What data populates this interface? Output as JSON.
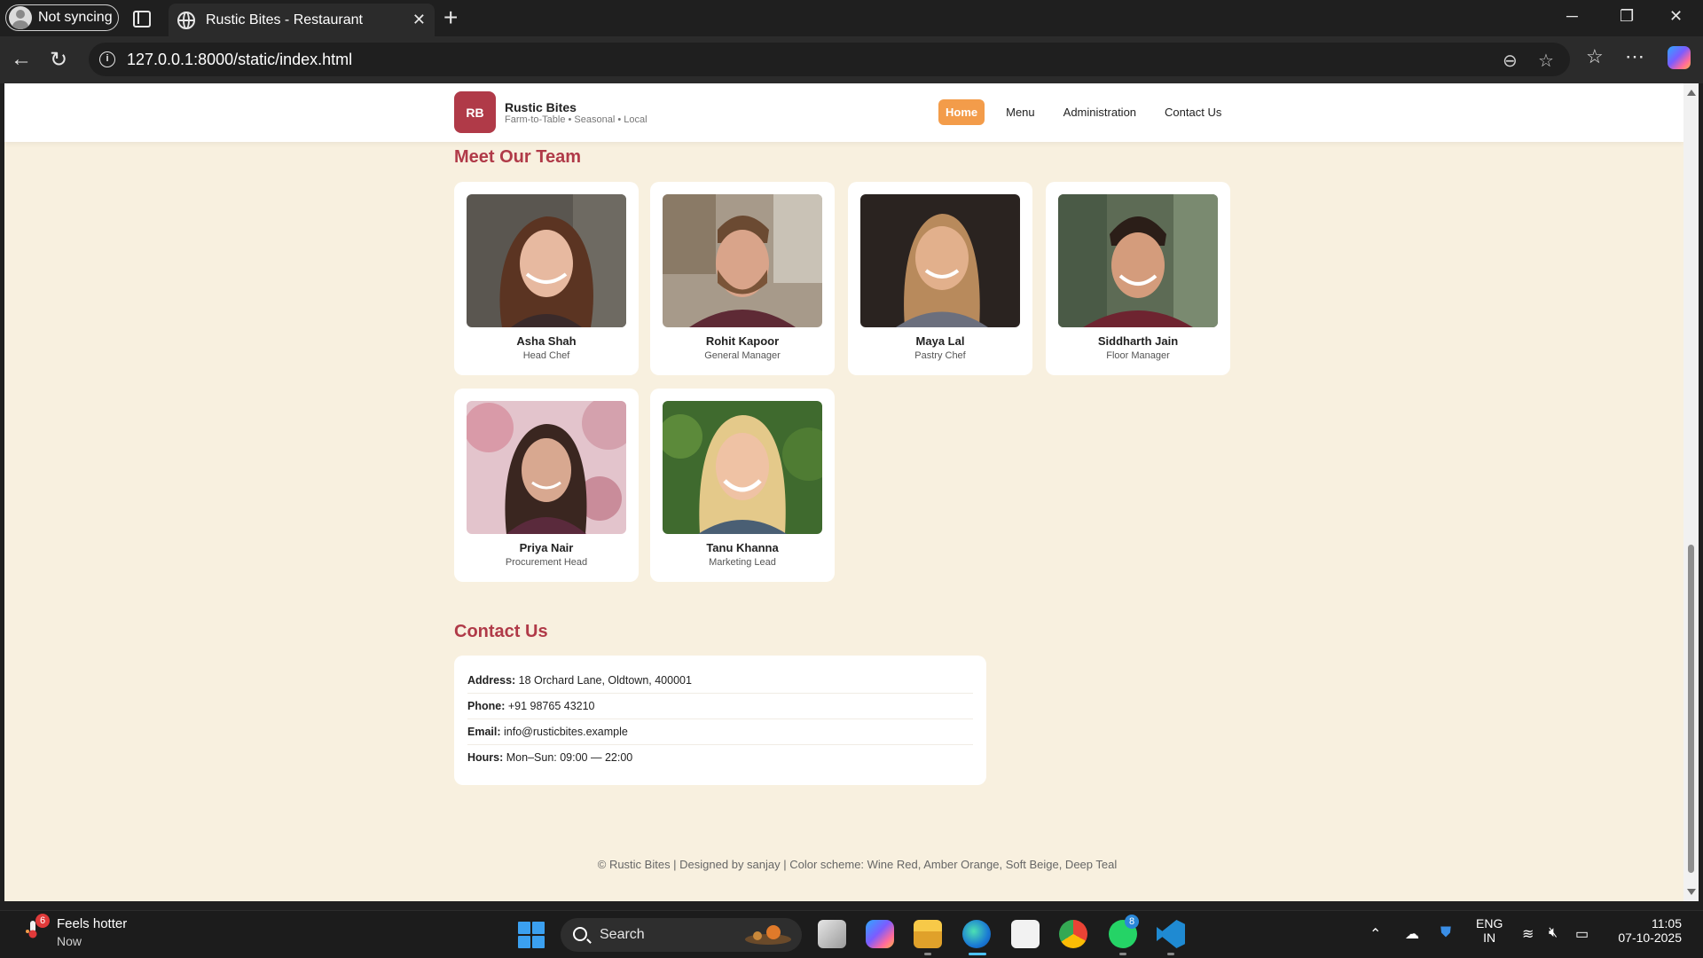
{
  "browser": {
    "profile_label": "Not syncing",
    "tab_title": "Rustic Bites - Restaurant",
    "url": "127.0.0.1:8000/static/index.html"
  },
  "site": {
    "logo_initials": "RB",
    "brand_name": "Rustic Bites",
    "tagline": "Farm-to-Table • Seasonal • Local",
    "nav": [
      {
        "label": "Home",
        "active": true
      },
      {
        "label": "Menu",
        "active": false
      },
      {
        "label": "Administration",
        "active": false
      },
      {
        "label": "Contact Us",
        "active": false
      }
    ]
  },
  "team": {
    "title": "Meet Our Team",
    "members": [
      {
        "name": "Asha Shah",
        "role": "Head Chef"
      },
      {
        "name": "Rohit Kapoor",
        "role": "General Manager"
      },
      {
        "name": "Maya Lal",
        "role": "Pastry Chef"
      },
      {
        "name": "Siddharth Jain",
        "role": "Floor Manager"
      },
      {
        "name": "Priya Nair",
        "role": "Procurement Head"
      },
      {
        "name": "Tanu Khanna",
        "role": "Marketing Lead"
      }
    ]
  },
  "contact": {
    "title": "Contact Us",
    "rows": [
      {
        "label": "Address:",
        "value": "18 Orchard Lane, Oldtown, 400001"
      },
      {
        "label": "Phone:",
        "value": "+91 98765 43210"
      },
      {
        "label": "Email:",
        "value": "info@rusticbites.example"
      },
      {
        "label": "Hours:",
        "value": "Mon–Sun: 09:00 — 22:00"
      }
    ]
  },
  "footer": {
    "text": "© Rustic Bites | Designed by sanjay | Color scheme: Wine Red, Amber Orange, Soft Beige, Deep Teal"
  },
  "taskbar": {
    "weather_badge": "6",
    "weather_title": "Feels hotter",
    "weather_sub": "Now",
    "search_label": "Search",
    "whatsapp_badge": "8",
    "language_top": "ENG",
    "language_bottom": "IN",
    "time": "11:05",
    "date": "07-10-2025"
  },
  "colors": {
    "wine_red": "#b03a48",
    "amber_orange": "#f39c4a",
    "soft_beige": "#f8f0df"
  }
}
